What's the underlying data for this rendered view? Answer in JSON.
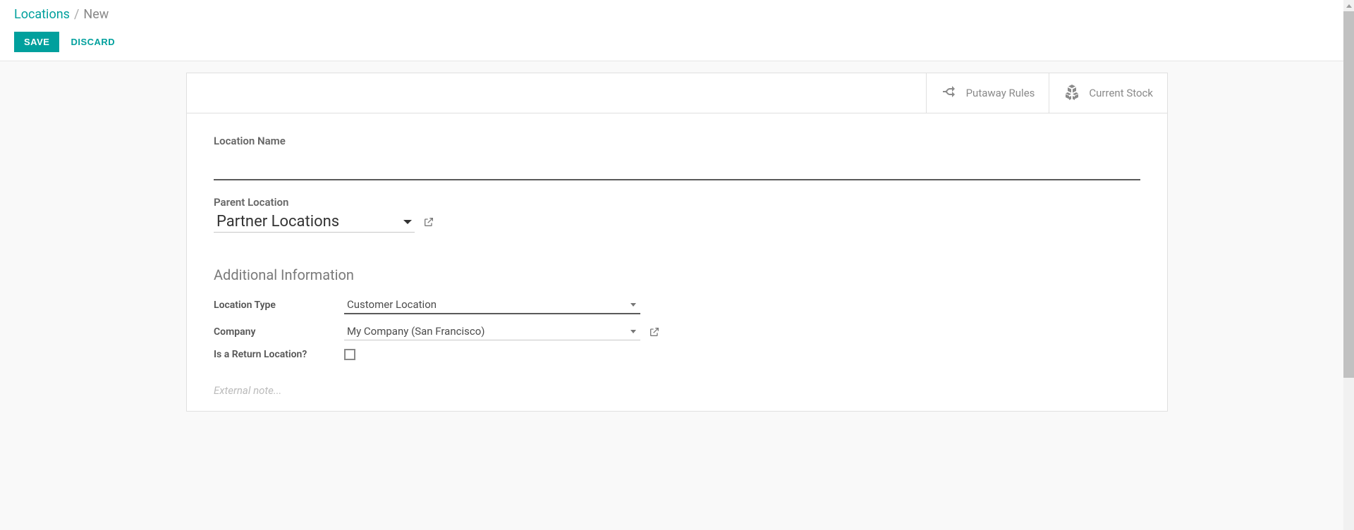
{
  "breadcrumb": {
    "link": "Locations",
    "separator": "/",
    "current": "New"
  },
  "actions": {
    "save": "SAVE",
    "discard": "DISCARD"
  },
  "statButtons": {
    "putaway": "Putaway Rules",
    "stock": "Current Stock"
  },
  "labels": {
    "locationName": "Location Name",
    "parentLocation": "Parent Location",
    "additionalInfo": "Additional Information",
    "locationType": "Location Type",
    "company": "Company",
    "isReturn": "Is a Return Location?"
  },
  "values": {
    "parentLocation": "Partner Locations",
    "locationType": "Customer Location",
    "company": "My Company (San Francisco)",
    "locationName": ""
  },
  "placeholders": {
    "externalNote": "External note..."
  }
}
